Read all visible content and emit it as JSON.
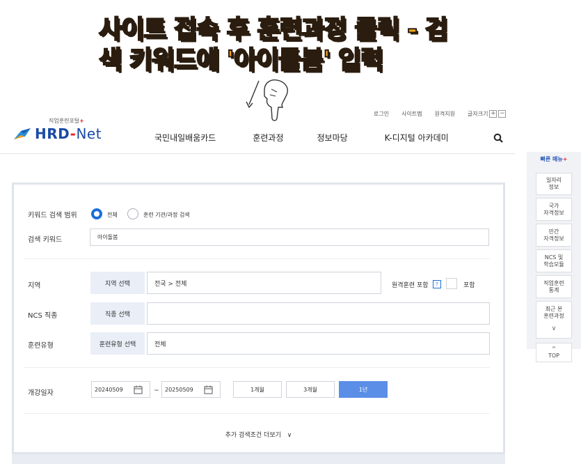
{
  "caption": {
    "line1": "사이트 접속 후 훈련과정 클릭 - 검",
    "line2": "색 키워드에 '아이돌봄' 입력"
  },
  "header": {
    "util_links": [
      "로그인",
      "사이트맵",
      "원격지원"
    ],
    "font_size_label": "글자크기",
    "font_plus": "+",
    "font_minus": "−",
    "logo_sub": "직업훈련포털",
    "logo_sub_plus": "+",
    "logo_hrd": "HRD",
    "logo_dash": "-",
    "logo_net": "Net",
    "nav": [
      "국민내일배움카드",
      "훈련과정",
      "정보마당",
      "K-디지털 아카데미"
    ]
  },
  "quick_menu": {
    "title": "빠른 메뉴",
    "title_plus": "+",
    "items": [
      [
        "일자리",
        "정보"
      ],
      [
        "국가",
        "자격정보"
      ],
      [
        "민간",
        "자격정보"
      ],
      [
        "NCS 및",
        "학습모듈"
      ],
      [
        "직업훈련",
        "통계"
      ],
      [
        "최근 본",
        "훈련과정"
      ]
    ],
    "top": "TOP",
    "top_arrow": "^",
    "down_arrow": "∨"
  },
  "search": {
    "keyword_scope_label": "키워드 검색 범위",
    "scope_options": [
      "전체",
      "훈련 기관/과정 검색"
    ],
    "keyword_label": "검색 키워드",
    "keyword_value": "아이돌봄",
    "region_label": "지역",
    "region_button": "지역 선택",
    "region_value": "전국 > 전체",
    "remote_label": "원격훈련 포함",
    "help_mark": "?",
    "include_label": "포함",
    "ncs_label": "NCS 직종",
    "ncs_button": "직종 선택",
    "ncs_value": "",
    "type_label": "훈련유형",
    "type_button": "훈련유형 선택",
    "type_value": "전체",
    "date_label": "개강일자",
    "date_start": "20240509",
    "date_tilde": "~",
    "date_end": "20250509",
    "periods": [
      "1개월",
      "3개월",
      "1년"
    ],
    "more_label": "추가 검색조건 더보기",
    "more_chevron": "∨"
  }
}
